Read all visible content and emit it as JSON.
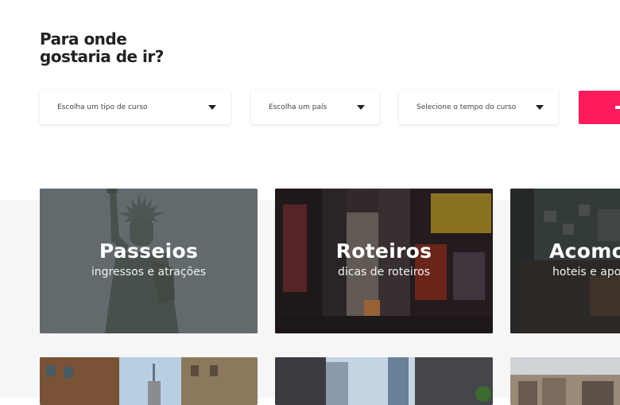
{
  "page": {
    "heading_line1": "Para onde",
    "heading_line2": "gostaria de ir?"
  },
  "filters": {
    "course_type": "Escolha um tipo de curso",
    "country": "Escolha um país",
    "course_time": "Selecione o tempo do curso"
  },
  "cards": [
    {
      "title": "Passeios",
      "subtitle": "ingressos e atrações",
      "image": "statue-of-liberty"
    },
    {
      "title": "Roteiros",
      "subtitle": "dicas de roteiros",
      "image": "times-square"
    },
    {
      "title": "Acomo",
      "subtitle": "hoteis e apo",
      "image": "apartment-interior"
    },
    {
      "image": "city-buildings"
    },
    {
      "image": "skyscrapers"
    },
    {
      "image": "city-skyline"
    }
  ],
  "colors": {
    "accent": "#ff1a5b",
    "text": "#222222",
    "section_bg": "#f6f6f6"
  }
}
